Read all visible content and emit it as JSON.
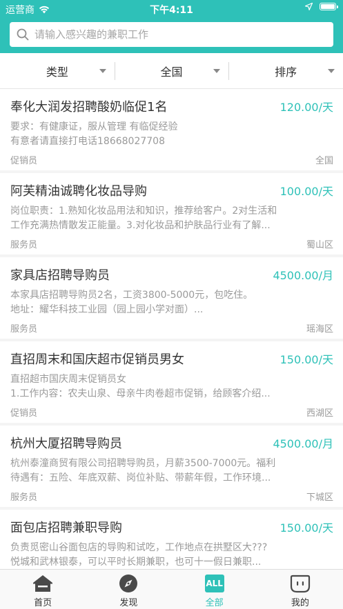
{
  "status_bar": {
    "carrier": "运营商",
    "time": "下午4:11"
  },
  "search": {
    "placeholder": "请输入感兴趣的兼职工作"
  },
  "filters": [
    {
      "label": "类型"
    },
    {
      "label": "全国"
    },
    {
      "label": "排序"
    }
  ],
  "jobs": [
    {
      "title": "奉化大润发招聘酸奶临促1名",
      "salary": "120.00/天",
      "desc_lines": [
        "要求：有健康证，服从管理 有临促经验",
        "有意者请直接打电话18668027708"
      ],
      "type": "促销员",
      "area": "全国"
    },
    {
      "title": "阿芙精油诚聘化妆品导购",
      "salary": "100.00/天",
      "desc_lines": [
        "岗位职责：1.熟知化妆品用法和知识，推荐给客户。2对生活和",
        "工作充满热情散发正能量。3.对化妆品和护肤品行业有了解..."
      ],
      "type": "服务员",
      "area": "蜀山区"
    },
    {
      "title": "家具店招聘导购员",
      "salary": "4500.00/月",
      "desc_lines": [
        "本家具店招聘导购员2名，工资3800-5000元，包吃住。",
        "地址：耀华科技工业园（园上园小学对面）..."
      ],
      "type": "服务员",
      "area": "瑶海区"
    },
    {
      "title": "直招周末和国庆超市促销员男女",
      "salary": "150.00/天",
      "desc_lines": [
        "直招超市国庆周末促销员女",
        "1.工作内容：农夫山泉、母亲牛肉卷超市促销，给顾客介绍..."
      ],
      "type": "促销员",
      "area": "西湖区"
    },
    {
      "title": "杭州大厦招聘导购员",
      "salary": "4500.00/月",
      "desc_lines": [
        "杭州泰潼商贸有限公司招聘导购员，月薪3500-7000元。福利",
        "待遇有：五险、年底双薪、岗位补贴、带薪年假，工作环境..."
      ],
      "type": "服务员",
      "area": "下城区"
    },
    {
      "title": "面包店招聘兼职导购",
      "salary": "150.00/天",
      "desc_lines": [
        "负责觅密山谷面包店的导购和试吃，工作地点在拱墅区大???",
        "悦城和武林银泰，可以平时长期兼职，也可十一假日兼职..."
      ],
      "type": "",
      "area": ""
    }
  ],
  "tabs": [
    {
      "label": "首页",
      "icon": "home-icon"
    },
    {
      "label": "发现",
      "icon": "compass-icon"
    },
    {
      "label": "全部",
      "icon": "all-icon",
      "icon_text": "ALL",
      "active": true
    },
    {
      "label": "我的",
      "icon": "profile-icon"
    }
  ],
  "colors": {
    "accent": "#2ec1b8",
    "text_primary": "#333333",
    "text_secondary": "#9a9a9a"
  }
}
